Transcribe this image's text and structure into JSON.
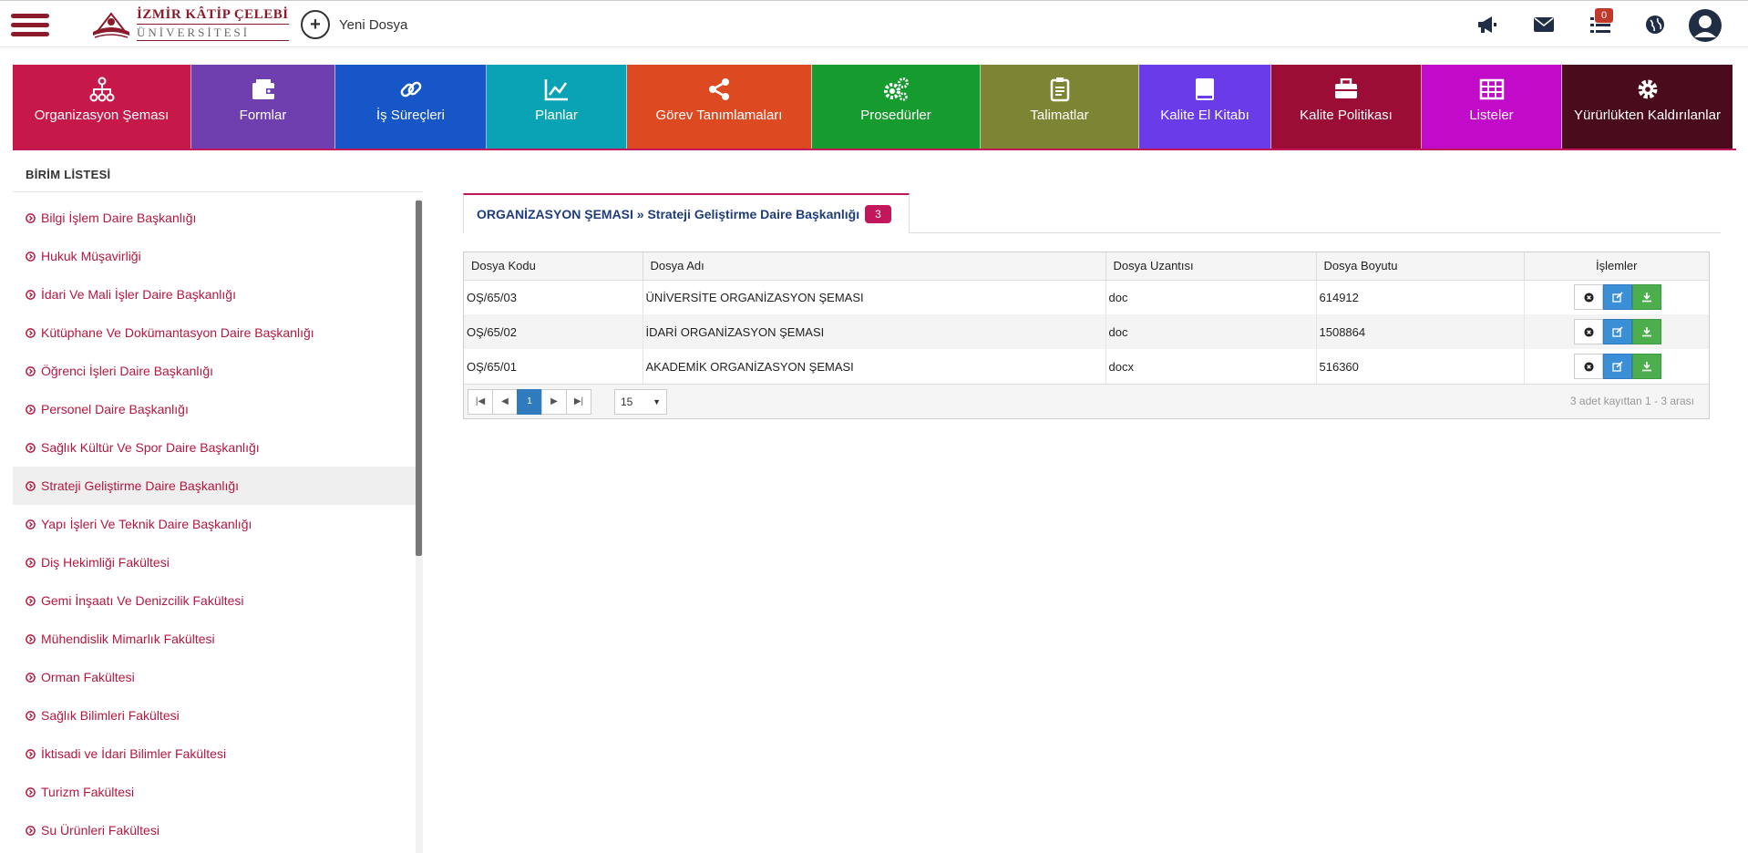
{
  "header": {
    "logo_line1": "İZMİR KÂTİP ÇELEBİ",
    "logo_line2": "ÜNİVERSİTESİ",
    "new_file_label": "Yeni Dosya",
    "notification_count": "0",
    "icons": [
      "megaphone-icon",
      "envelope-icon",
      "list-icon",
      "globe-icon",
      "user-avatar-icon"
    ]
  },
  "modules": [
    {
      "label": "Organizasyon Şeması",
      "color": "#c7184a",
      "icon": "org-chart-icon"
    },
    {
      "label": "Formlar",
      "color": "#6f3fb0",
      "icon": "wallet-icon"
    },
    {
      "label": "İş Süreçleri",
      "color": "#1656c7",
      "icon": "link-icon"
    },
    {
      "label": "Planlar",
      "color": "#0aa3b5",
      "icon": "line-chart-icon"
    },
    {
      "label": "Görev Tanımlamaları",
      "color": "#dd4a22",
      "icon": "share-icon"
    },
    {
      "label": "Prosedürler",
      "color": "#169b2f",
      "icon": "gears-icon"
    },
    {
      "label": "Talimatlar",
      "color": "#7d8534",
      "icon": "clipboard-icon"
    },
    {
      "label": "Kalite El Kitabı",
      "color": "#6a3ce9",
      "icon": "book-icon"
    },
    {
      "label": "Kalite Politikası",
      "color": "#9b0d34",
      "icon": "briefcase-icon"
    },
    {
      "label": "Listeler",
      "color": "#c10bc9",
      "icon": "table-icon"
    },
    {
      "label": "Yürürlükten Kaldırılanlar",
      "color": "#4a0b1c",
      "icon": "gear-icon"
    }
  ],
  "sidebar": {
    "title": "BİRİM LİSTESİ",
    "items": [
      "Bilgi İşlem Daire Başkanlığı",
      "Hukuk Müşavirliği",
      "İdari Ve Mali İşler Daire Başkanlığı",
      "Kütüphane Ve Dokümantasyon Daire Başkanlığı",
      "Öğrenci İşleri Daire Başkanlığı",
      "Personel Daire Başkanlığı",
      "Sağlık Kültür Ve Spor Daire Başkanlığı",
      "Strateji Geliştirme Daire Başkanlığı",
      "Yapı İşleri Ve Teknik Daire Başkanlığı",
      "Diş Hekimliği Fakültesi",
      "Gemi İnşaatı Ve Denizcilik Fakültesi",
      "Mühendislik Mimarlık Fakültesi",
      "Orman Fakültesi",
      "Sağlık Bilimleri Fakültesi",
      "İktisadi ve İdari Bilimler Fakültesi",
      "Turizm Fakültesi",
      "Su Ürünleri Fakültesi"
    ],
    "active_index": 7
  },
  "tab": {
    "breadcrumb": "ORGANİZASYON ŞEMASI » Strateji Geliştirme Daire Başkanlığı",
    "count": "3"
  },
  "table": {
    "columns": [
      "Dosya Kodu",
      "Dosya Adı",
      "Dosya Uzantısı",
      "Dosya Boyutu",
      "İşlemler"
    ],
    "rows": [
      [
        "OŞ/65/03",
        "ÜNİVERSİTE ORGANİZASYON ŞEMASI",
        "doc",
        "614912"
      ],
      [
        "OŞ/65/02",
        "İDARİ ORGANİZASYON ŞEMASI",
        "doc",
        "1508864"
      ],
      [
        "OŞ/65/01",
        "AKADEMİK ORGANİZASYON ŞEMASI",
        "docx",
        "516360"
      ]
    ]
  },
  "pager": {
    "current_page": "1",
    "page_size": "15",
    "info": "3 adet kayıttan 1 - 3 arası"
  }
}
